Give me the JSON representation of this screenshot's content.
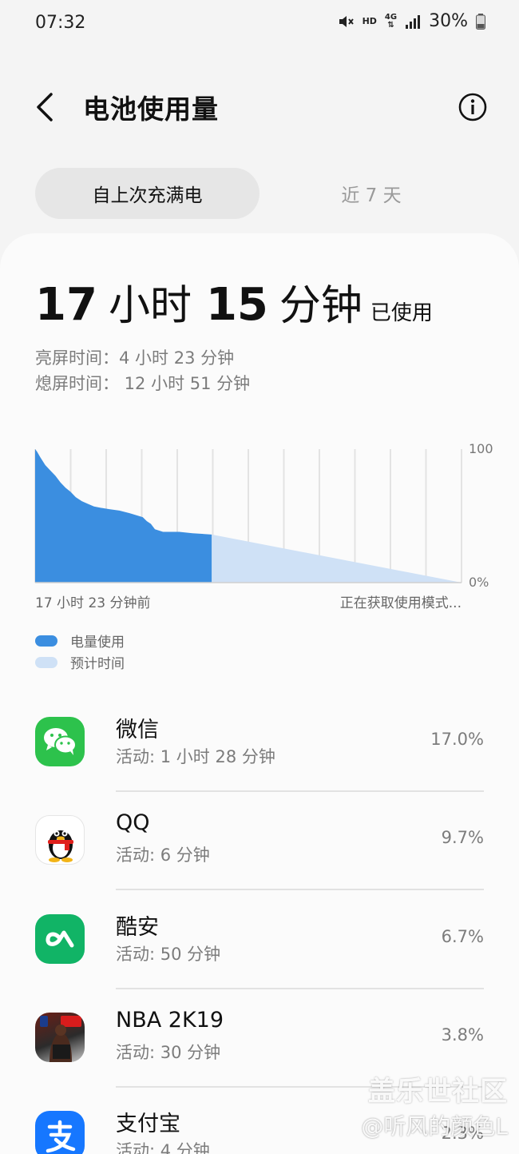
{
  "status_bar": {
    "time": "07:32",
    "hd": "HD",
    "network": "4G",
    "battery": "30%"
  },
  "header": {
    "title": "电池使用量",
    "back_icon": "chevron-left-icon",
    "info_icon": "info-icon"
  },
  "tabs": {
    "since_full_charge": "自上次充满电",
    "last_7_days": "近 7 天"
  },
  "summary": {
    "hours": "17",
    "hours_unit": "小时",
    "minutes": "15",
    "minutes_unit": "分钟",
    "used_label": "已使用",
    "screen_on": "亮屏时间：4 小时 23 分钟",
    "screen_off": "熄屏时间： 12 小时 51 分钟"
  },
  "chart_data": {
    "type": "area",
    "ylim": [
      0,
      100
    ],
    "y_ticks": [
      "100",
      "0%"
    ],
    "x_start_label": "17 小时 23 分钟前",
    "x_end_label": "正在获取使用模式...",
    "series": [
      {
        "name": "电量使用",
        "color": "#3b8ee0",
        "x": [
          0,
          0.2,
          0.5,
          1.0,
          1.5,
          2.0,
          2.5,
          3.0,
          3.5,
          4.0,
          4.6,
          5.2,
          5.8,
          6.5,
          7.3,
          8.3,
          9.3,
          10.6,
          11.0,
          11.4,
          11.8,
          12.6,
          13.4,
          14.2,
          15.5,
          17.4
        ],
        "values": [
          100,
          98,
          94,
          88,
          84,
          80,
          75,
          71,
          68,
          64,
          61,
          59,
          57,
          56,
          55,
          54,
          52,
          49,
          46,
          44,
          40,
          38,
          38,
          38,
          37,
          36
        ]
      },
      {
        "name": "预计时间",
        "color": "#cfe1f6",
        "x": [
          17.4,
          42.0
        ],
        "values": [
          36,
          0
        ]
      }
    ],
    "legend": [
      "电量使用",
      "预计时间"
    ]
  },
  "apps": [
    {
      "name": "微信",
      "active": "活动: 1 小时 28 分钟",
      "percent": "17.0%",
      "icon": "wechat-icon"
    },
    {
      "name": "QQ",
      "active": "活动: 6 分钟",
      "percent": "9.7%",
      "icon": "qq-icon"
    },
    {
      "name": "酷安",
      "active": "活动: 50 分钟",
      "percent": "6.7%",
      "icon": "coolapk-icon"
    },
    {
      "name": "NBA 2K19",
      "active": "活动: 30 分钟",
      "percent": "3.8%",
      "icon": "nba2k19-icon"
    },
    {
      "name": "支付宝",
      "active": "活动: 4 分钟",
      "percent": "2.3%",
      "icon": "alipay-icon"
    }
  ],
  "watermark": {
    "title": "盖乐世社区",
    "user": "@听风的颜色L"
  }
}
